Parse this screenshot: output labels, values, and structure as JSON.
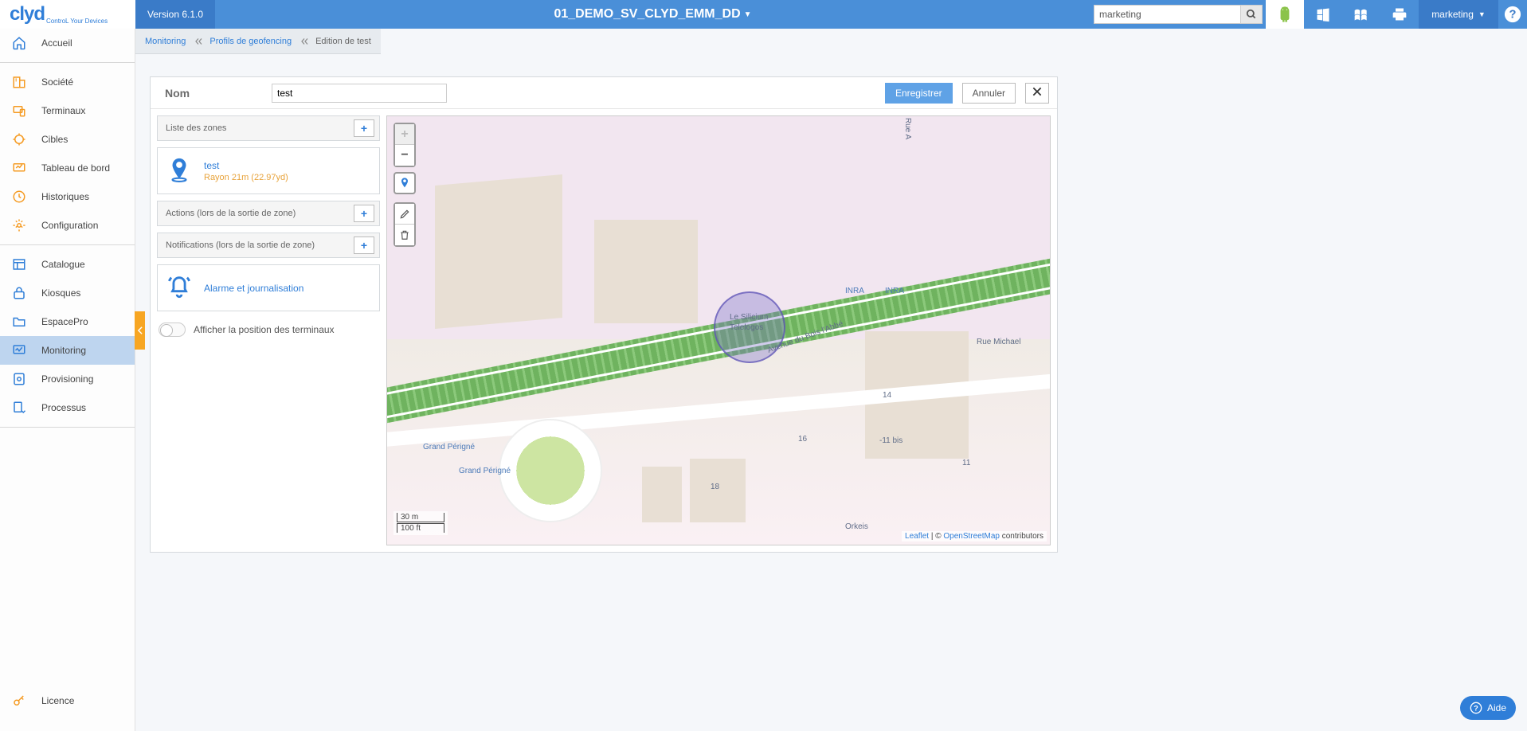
{
  "header": {
    "version": "Version 6.1.0",
    "title": "01_DEMO_SV_CLYD_EMM_DD",
    "search_value": "marketing",
    "user": "marketing",
    "logo_tagline": "ControL Your Devices",
    "logo_text": "clyd"
  },
  "breadcrumb": {
    "items": [
      "Monitoring",
      "Profils de geofencing"
    ],
    "current": "Edition de test"
  },
  "sidebar": {
    "home": "Accueil",
    "societe": "Société",
    "terminaux": "Terminaux",
    "cibles": "Cibles",
    "tableau": "Tableau de bord",
    "historiques": "Historiques",
    "configuration": "Configuration",
    "catalogue": "Catalogue",
    "kiosques": "Kiosques",
    "espacepro": "EspacePro",
    "monitoring": "Monitoring",
    "provisioning": "Provisioning",
    "processus": "Processus",
    "licence": "Licence"
  },
  "form": {
    "nom_label": "Nom",
    "nom_value": "test",
    "save": "Enregistrer",
    "cancel": "Annuler"
  },
  "sections": {
    "zones_title": "Liste des zones",
    "actions_title": "Actions (lors de la sortie de zone)",
    "notifications_title": "Notifications (lors de la sortie de zone)"
  },
  "zone": {
    "name": "test",
    "radius": "Rayon 21m (22.97yd)"
  },
  "notification": {
    "label": "Alarme et journalisation"
  },
  "toggle": {
    "show_positions": "Afficher la position des terminaux"
  },
  "map": {
    "scale_m": "30 m",
    "scale_ft": "100 ft",
    "attribution_leaflet": "Leaflet",
    "attribution_osm": "OpenStreetMap",
    "attribution_contrib": " contributors",
    "labels": {
      "lesilicium": "Le Silicium",
      "telelogos": "Telelogos",
      "grand_perigne_1": "Grand Périgné",
      "grand_perigne_2": "Grand Périgné",
      "inra1": "INRA",
      "inra2": "INRA",
      "rue_michael": "Rue Michael",
      "rue_a": "Rue A",
      "avenue": "Avenue du Bois l'Abbé",
      "orkeis": "Orkeis",
      "n14": "14",
      "n16": "16",
      "n18": "18",
      "n11bis": "-11 bis",
      "n11": "11"
    }
  },
  "help": "Aide"
}
